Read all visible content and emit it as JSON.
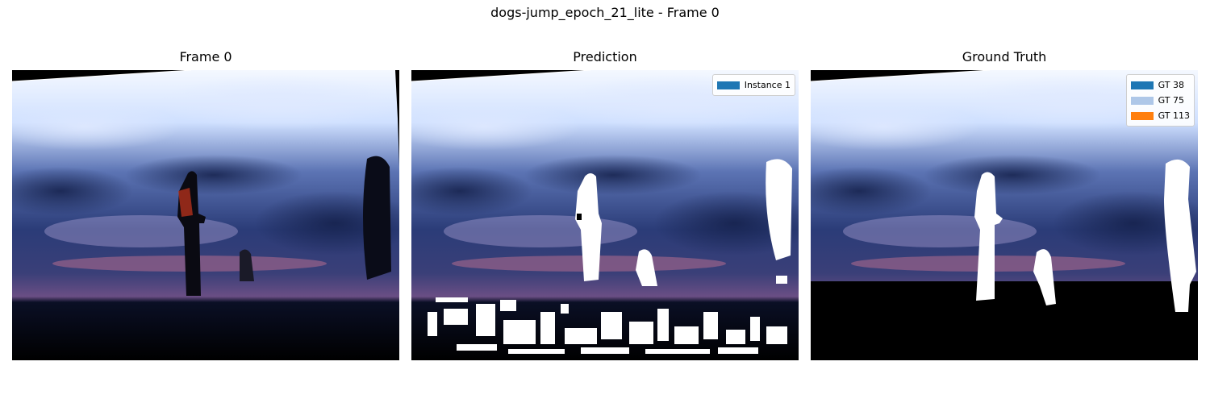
{
  "figure": {
    "title": "dogs-jump_epoch_21_lite - Frame 0"
  },
  "panels": {
    "frame": {
      "title": "Frame 0"
    },
    "prediction": {
      "title": "Prediction",
      "legend": [
        {
          "label": "Instance 1",
          "color": "#1f77b4"
        }
      ]
    },
    "ground_truth": {
      "title": "Ground Truth",
      "legend": [
        {
          "label": "GT 38",
          "color": "#1f77b4"
        },
        {
          "label": "GT 75",
          "color": "#aec7e8"
        },
        {
          "label": "GT 113",
          "color": "#ff7f0e"
        }
      ]
    }
  },
  "colors": {
    "mask": "#ffffff",
    "background": "#000000",
    "sky_dark": "#1a2a55",
    "sky_light": "#e8f0ff"
  }
}
